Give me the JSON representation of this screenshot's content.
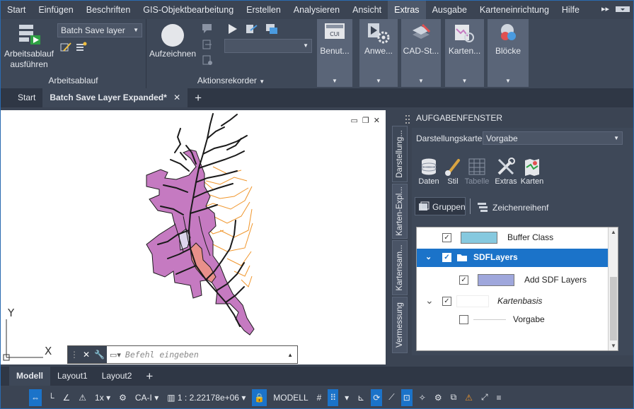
{
  "menu": {
    "items": [
      "Start",
      "Einfügen",
      "Beschriften",
      "GIS-Objektbearbeitung",
      "Erstellen",
      "Analysieren",
      "Ansicht",
      "Extras",
      "Ausgabe",
      "Karteneinrichtung",
      "Hilfe"
    ],
    "active": "Extras",
    "more_glyph": "▸▸"
  },
  "ribbon": {
    "run_workflow_label": "Arbeitsablauf ausführen",
    "workflow_combo": "Batch Save layer",
    "workflow_panel_title": "Arbeitsablauf",
    "record_label": "Aufzeichnen",
    "action_recorder_title": "Aktionsrekorder",
    "action_combo": "",
    "tiles": [
      {
        "label": "Benut...",
        "icon": "cui-icon"
      },
      {
        "label": "Anwe...",
        "icon": "gear-play-icon"
      },
      {
        "label": "CAD-St...",
        "icon": "layers-icon"
      },
      {
        "label": "Karten...",
        "icon": "map-tool-icon"
      },
      {
        "label": "Blöcke",
        "icon": "blocks-icon"
      }
    ]
  },
  "doc_tabs": {
    "start": "Start",
    "active": "Batch Save Layer Expanded*",
    "close": "✕",
    "add": "+"
  },
  "canvas": {
    "axis_y": "Y",
    "axis_x": "X"
  },
  "command": {
    "placeholder": "Befehl eingeben"
  },
  "taskpane": {
    "title": "AUFGABENFENSTER",
    "vertical_tabs": [
      "Darstellung...",
      "Karten-Expl...",
      "Kartensam...",
      "Vermessung"
    ],
    "display_map_label": "Darstellungskarte:",
    "display_map_value": "Vorgabe",
    "tools": [
      "Daten",
      "Stil",
      "Tabelle",
      "Extras",
      "Karten"
    ],
    "groups_label": "Gruppen",
    "draw_order_label": "Zeichenreihenf",
    "layers": [
      {
        "name": "Buffer Class",
        "checked": true,
        "swatch": "#86c9df",
        "indent": 1
      },
      {
        "name": "SDFLayers",
        "checked": true,
        "group": true,
        "selected": true
      },
      {
        "name": "Add SDF Layers",
        "checked": true,
        "swatch": "#9fa7dc",
        "indent": 2
      },
      {
        "name": "Kartenbasis",
        "checked": true,
        "italic": true
      },
      {
        "name": "Vorgabe",
        "checked": false,
        "indent": 1
      }
    ]
  },
  "layout_tabs": [
    "Modell",
    "Layout1",
    "Layout2",
    "+"
  ],
  "status": {
    "scale_1x": "1x",
    "annotation": "CA-I",
    "scale": "1 : 2.22178e+06",
    "model": "MODELL"
  },
  "colors": {
    "accent": "#1b73c9",
    "purple": "#c57ac1",
    "orange": "#f0952a",
    "dark": "#1a1a1a"
  }
}
